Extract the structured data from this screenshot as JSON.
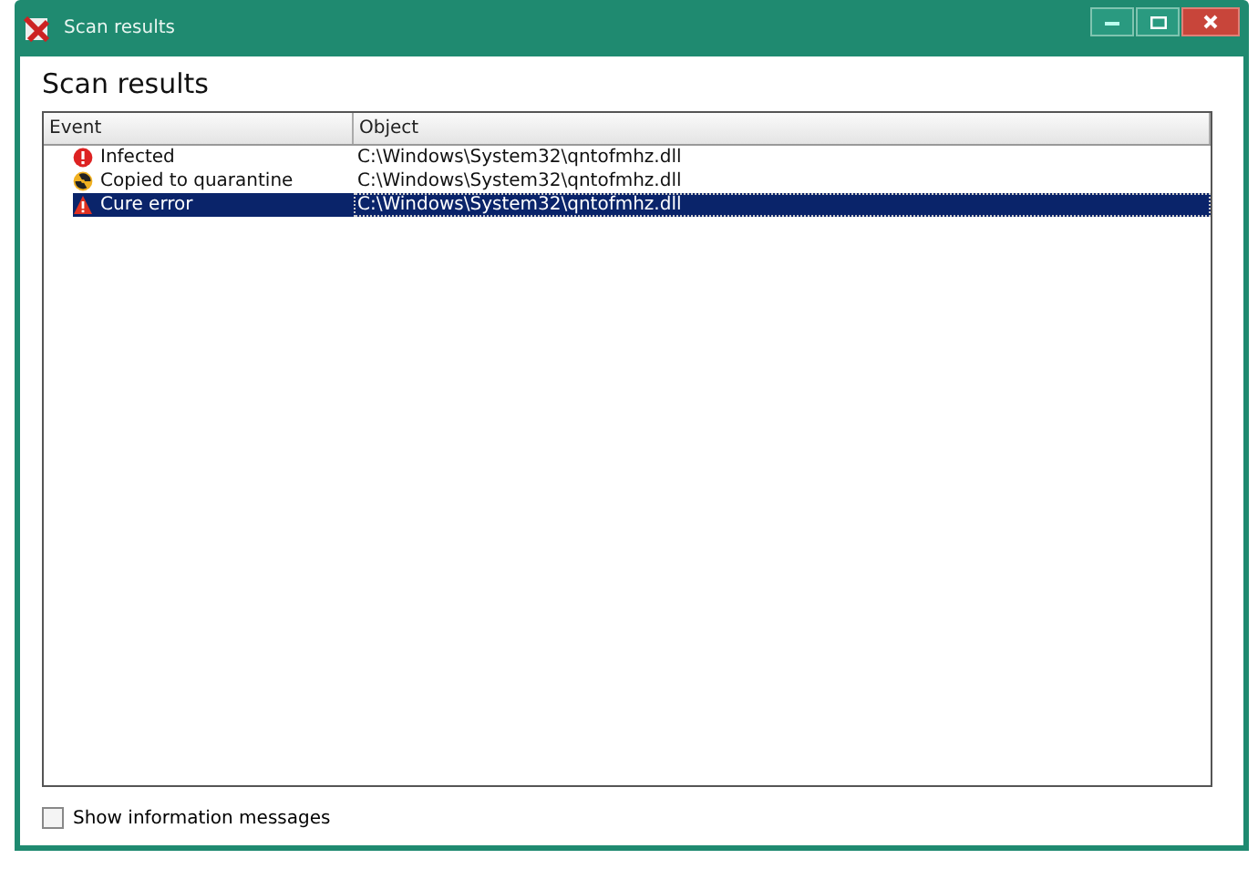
{
  "window": {
    "title": "Scan results"
  },
  "heading": "Scan results",
  "table": {
    "columns": [
      "Event",
      "Object"
    ],
    "rows": [
      {
        "kind": "infected",
        "event": "Infected",
        "object": "C:\\Windows\\System32\\qntofmhz.dll",
        "selected": false
      },
      {
        "kind": "quarantine",
        "event": "Copied to quarantine",
        "object": "C:\\Windows\\System32\\qntofmhz.dll",
        "selected": false
      },
      {
        "kind": "error",
        "event": "Cure error",
        "object": "C:\\Windows\\System32\\qntofmhz.dll",
        "selected": true
      }
    ]
  },
  "show_info": {
    "label": "Show information messages",
    "checked": false
  }
}
